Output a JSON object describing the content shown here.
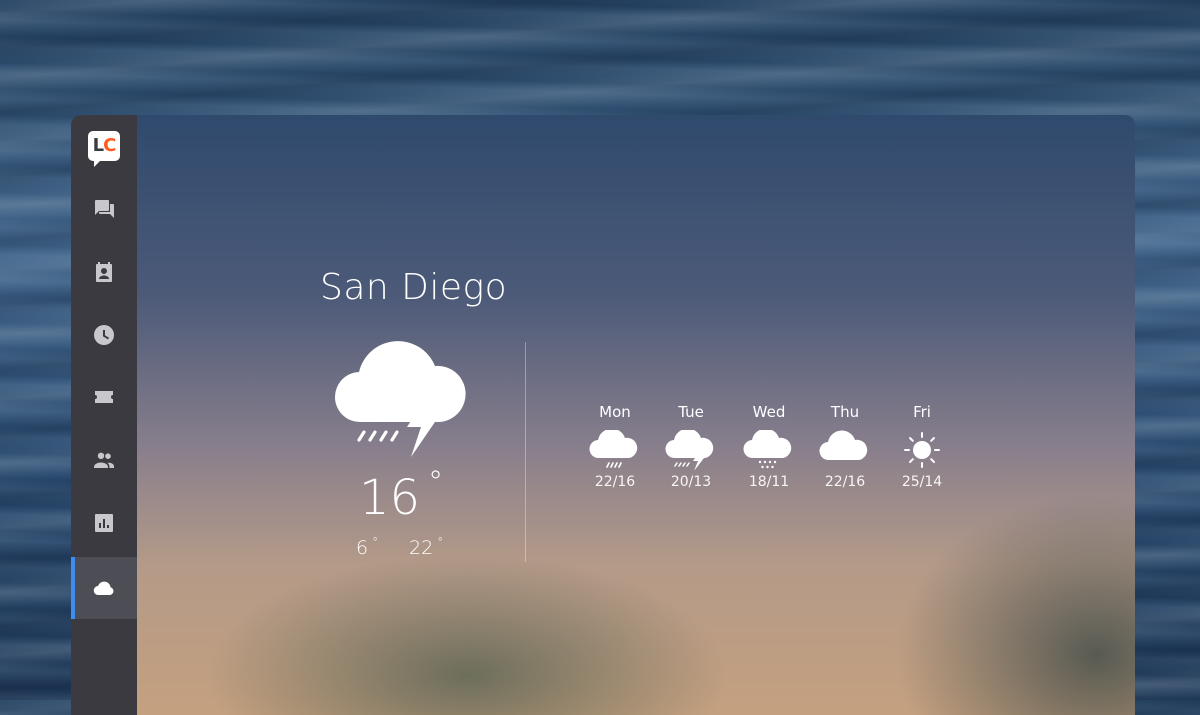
{
  "sidebar": {
    "logo": {
      "l": "L",
      "c": "C"
    },
    "items": [
      {
        "icon": "chat-icon"
      },
      {
        "icon": "contacts-icon"
      },
      {
        "icon": "clock-icon"
      },
      {
        "icon": "ticket-icon"
      },
      {
        "icon": "people-icon"
      },
      {
        "icon": "bar-chart-icon"
      },
      {
        "icon": "cloud-icon",
        "active": true
      }
    ],
    "accent_color": "#3d8ef0"
  },
  "weather": {
    "city": "San Diego",
    "current_icon": "thunderstorm-icon",
    "temp": "16",
    "degree": "°",
    "low": "6",
    "high": "22"
  },
  "forecast": [
    {
      "day": "Mon",
      "icon": "rain-icon",
      "range": "22/16"
    },
    {
      "day": "Tue",
      "icon": "thunderstorm-icon",
      "range": "20/13"
    },
    {
      "day": "Wed",
      "icon": "snow-icon",
      "range": "18/11"
    },
    {
      "day": "Thu",
      "icon": "cloud-icon",
      "range": "22/16"
    },
    {
      "day": "Fri",
      "icon": "sun-icon",
      "range": "25/14"
    }
  ]
}
